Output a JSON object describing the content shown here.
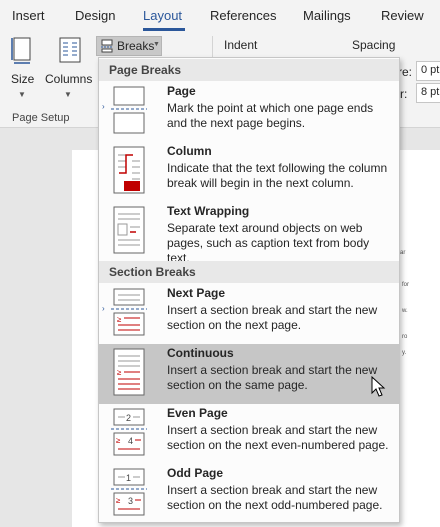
{
  "ribbon_tabs": [
    {
      "label": "Insert"
    },
    {
      "label": "Design"
    },
    {
      "label": "Layout",
      "active": true
    },
    {
      "label": "References"
    },
    {
      "label": "Mailings"
    },
    {
      "label": "Review"
    }
  ],
  "ribbon": {
    "size_label": "Size",
    "columns_label": "Columns",
    "breaks_label": "Breaks",
    "group_label": "Page Setup",
    "indent_label": "Indent",
    "spacing_label": "Spacing",
    "before_suffix": "re:",
    "after_suffix": "r:",
    "before_value": "0 pt",
    "after_value": "8 pt"
  },
  "menu": {
    "page_breaks_header": "Page Breaks",
    "section_breaks_header": "Section Breaks",
    "items": [
      {
        "title": "Page",
        "description": "Mark the point at which one page ends and the next page begins.",
        "icon": "page-break-icon"
      },
      {
        "title": "Column",
        "description": "Indicate that the text following the column break will begin in the next column.",
        "icon": "column-break-icon"
      },
      {
        "title": "Text Wrapping",
        "description": "Separate text around objects on web pages, such as caption text from body text.",
        "icon": "text-wrapping-break-icon"
      },
      {
        "title": "Next Page",
        "description": "Insert a section break and start the new section on the next page.",
        "icon": "next-page-section-icon"
      },
      {
        "title": "Continuous",
        "description": "Insert a section break and start the new section on the same page.",
        "icon": "continuous-section-icon",
        "hovered": true
      },
      {
        "title": "Even Page",
        "description": "Insert a section break and start the new section on the next even-numbered page.",
        "icon": "even-page-section-icon",
        "page_numbers": [
          "2",
          "4"
        ]
      },
      {
        "title": "Odd Page",
        "description": "Insert a section break and start the new section on the next odd-numbered page.",
        "icon": "odd-page-section-icon",
        "page_numbers": [
          "1",
          "3"
        ]
      }
    ]
  },
  "document_fragments": [
    "ar",
    "for",
    "w.",
    "ro",
    "y."
  ],
  "colors": {
    "accent": "#2b579a",
    "break_red": "#c00000",
    "hover": "#c6c6c6"
  }
}
